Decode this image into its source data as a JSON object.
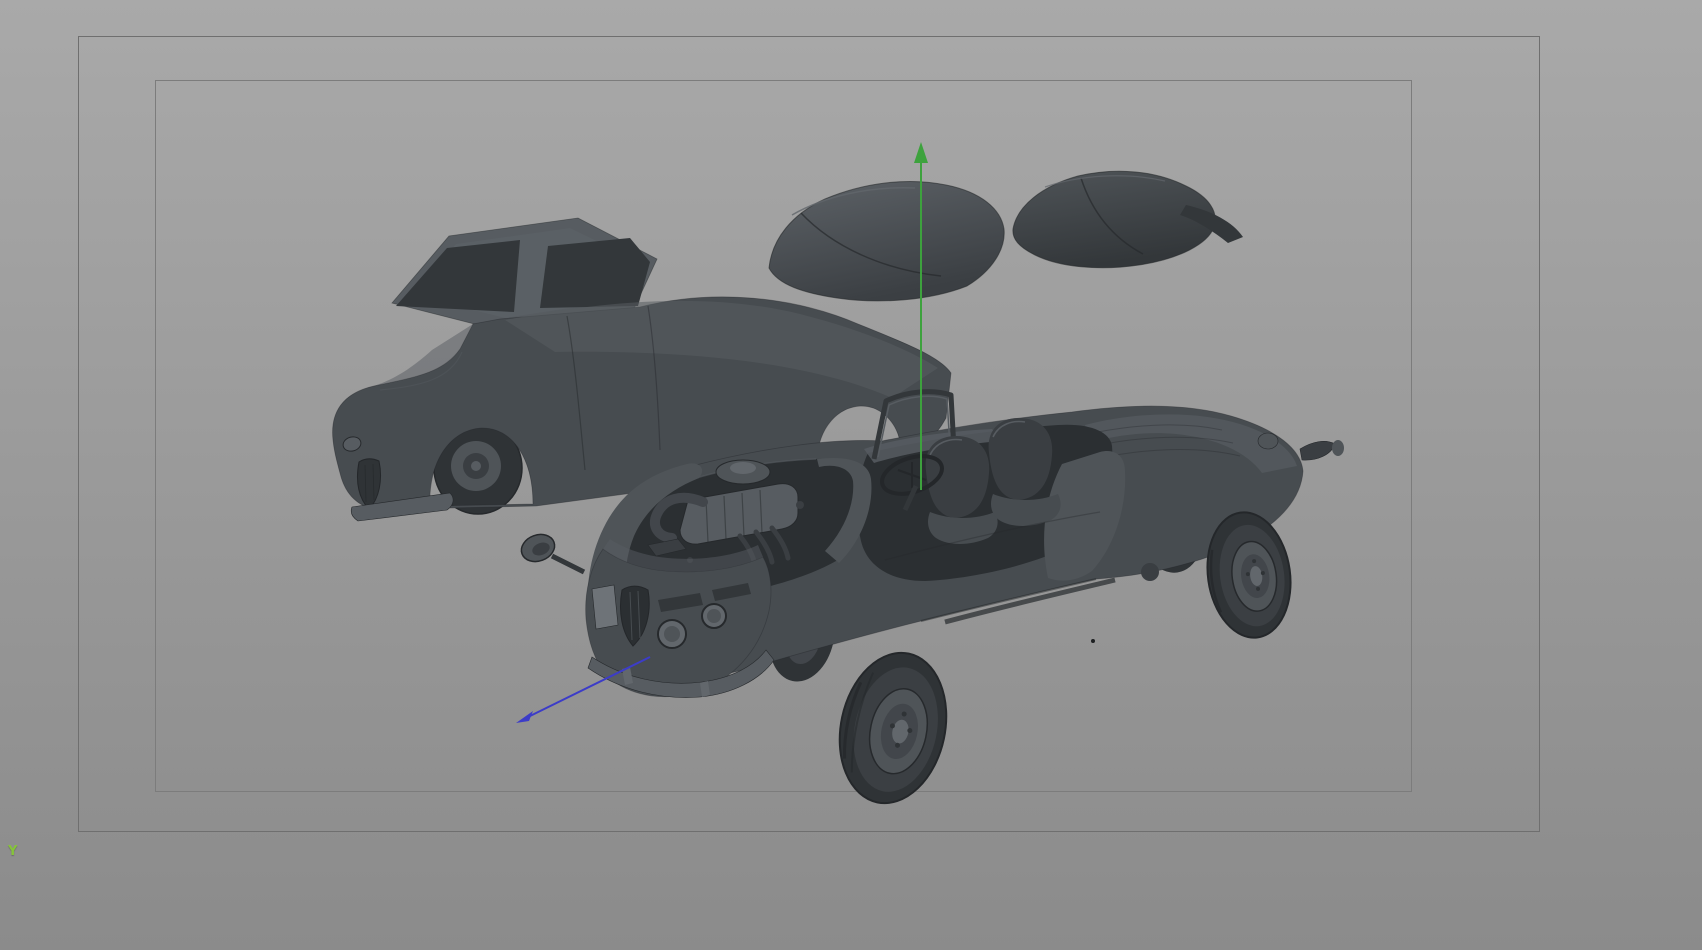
{
  "colors": {
    "bg-top": "#a9a9a9",
    "bg-bottom": "#8b8b8b",
    "frame-outer": "#6f6f6f",
    "frame-inner": "#7c7c7c",
    "outline": "#26292c",
    "tread-outline": "#24272a",
    "darkest": "#2f3336",
    "dark": "#3a3e42",
    "mid": "#474c50",
    "mid2": "#4f5458",
    "light": "#575c61",
    "lighter": "#62676c",
    "cavity": "#2b2f32",
    "tire-sidewall": "#3b3f43",
    "rim-inner": "#42464b",
    "plate": "#6e7378",
    "glass-top": "#5d6267",
    "glass-bottom": "#3b3f43",
    "glass-dark": "#33373a",
    "axis-y": "#3da23d",
    "axis-z": "#3c3cc8",
    "gizmo-y": "#86c43a"
  },
  "axis_gizmo": {
    "y_label": "Y"
  },
  "manipulator": {
    "y_axis_direction": "up",
    "z_axis_direction": "lower-left"
  },
  "scene": {
    "description": "exploded 3d model of a classic car in a shaded viewport",
    "parts": [
      "car-body-shell",
      "glass-canopy-front",
      "glass-canopy-rear",
      "chassis",
      "engine",
      "seat-left",
      "seat-right",
      "steering-wheel",
      "windshield-frame",
      "front-grille-shield",
      "headlights",
      "front-bumper",
      "headlamp-pod",
      "wheel-front-large",
      "wheel-rear-right",
      "wheel-rear-hidden",
      "wheel-front-hidden",
      "tail-bumperette"
    ]
  }
}
